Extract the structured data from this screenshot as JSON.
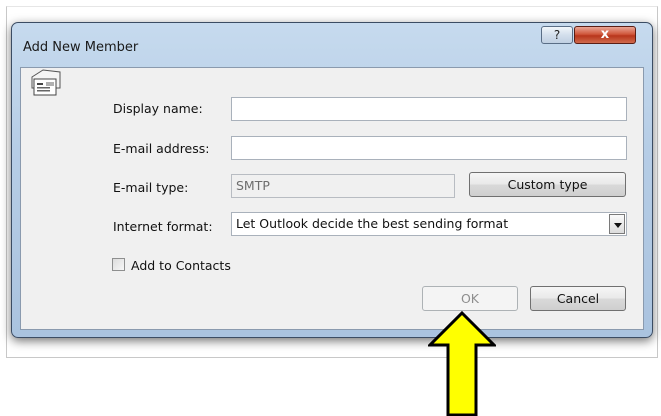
{
  "dialog": {
    "title": "Add New Member",
    "help_label": "?",
    "close_label": "x"
  },
  "form": {
    "display_name": {
      "label": "Display name:",
      "value": ""
    },
    "email_address": {
      "label": "E-mail address:",
      "value": ""
    },
    "email_type": {
      "label": "E-mail type:",
      "value": "SMTP",
      "button": "Custom type"
    },
    "internet_format": {
      "label": "Internet format:",
      "value": "Let Outlook decide the best sending format"
    },
    "add_to_contacts": {
      "label": "Add to Contacts",
      "checked": false
    }
  },
  "buttons": {
    "ok": "OK",
    "cancel": "Cancel"
  },
  "icons": {
    "contact_card": "contact-card-icon",
    "callout_arrow": "arrow-up-icon"
  },
  "colors": {
    "title_bar": "#b9d1ea",
    "close_button": "#c7442a",
    "dialog_face": "#f0f0f0",
    "callout_arrow_fill": "#ffff00"
  }
}
